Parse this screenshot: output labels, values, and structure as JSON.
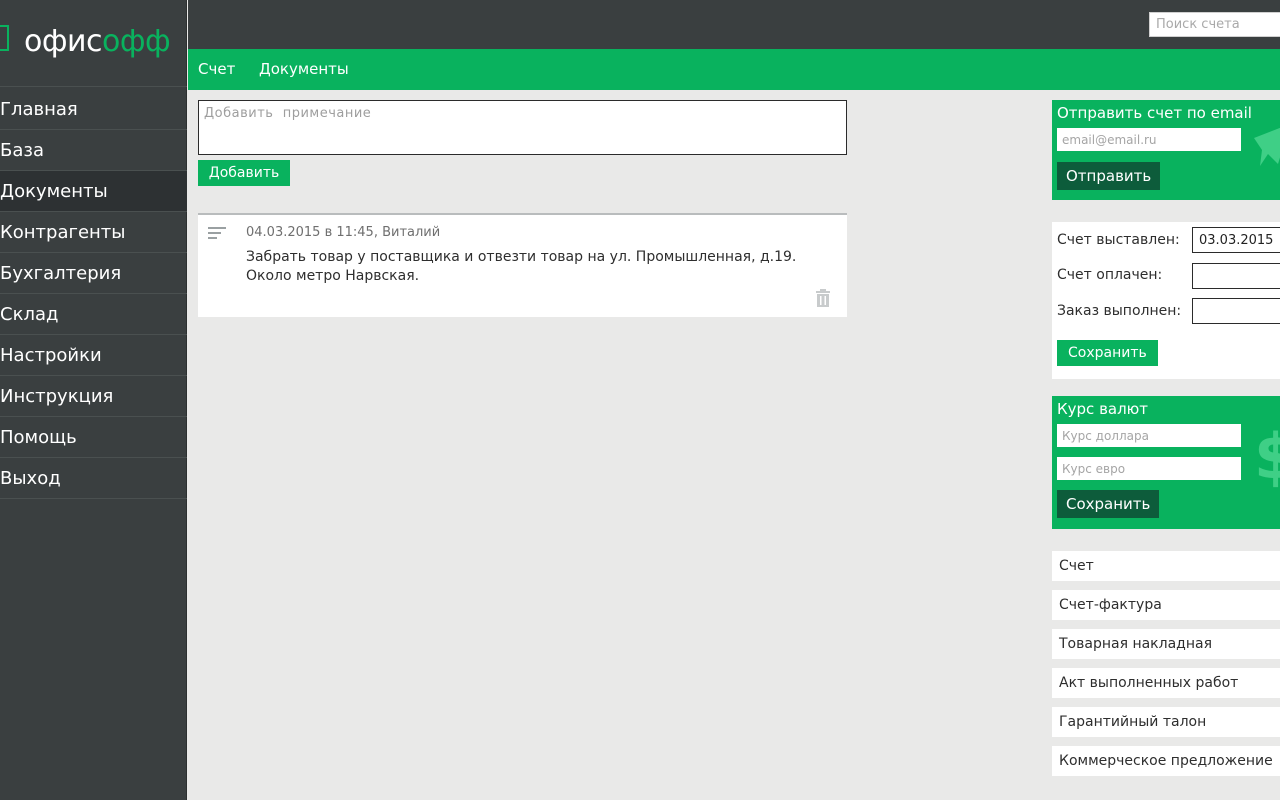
{
  "logo": {
    "part1": "офис",
    "part2": "офф"
  },
  "sidebar": {
    "items": [
      {
        "label": "Главная"
      },
      {
        "label": "База"
      },
      {
        "label": "Документы"
      },
      {
        "label": "Контрагенты"
      },
      {
        "label": "Бухгалтерия"
      },
      {
        "label": "Склад"
      },
      {
        "label": "Настройки"
      },
      {
        "label": "Инструкция"
      },
      {
        "label": "Помощь"
      },
      {
        "label": "Выход"
      }
    ],
    "active_index": 2
  },
  "search": {
    "placeholder": "Поиск счета",
    "value": ""
  },
  "tabs": [
    {
      "label": "Счет"
    },
    {
      "label": "Документы"
    }
  ],
  "note_form": {
    "placeholder": "Добавить  примечание",
    "add_label": "Добавить"
  },
  "notes": [
    {
      "meta": "04.03.2015 в 11:45, Виталий",
      "text": "Забрать товар у поставщика и отвезти товар на ул. Промышленная, д.19. Около метро Нарвская."
    }
  ],
  "email_panel": {
    "title": "Отправить счет по email",
    "placeholder": "email@email.ru",
    "send_label": "Отправить"
  },
  "status_panel": {
    "rows": [
      {
        "label": "Счет выставлен:",
        "value": "03.03.2015"
      },
      {
        "label": "Счет оплачен:",
        "value": ""
      },
      {
        "label": "Заказ выполнен:",
        "value": ""
      }
    ],
    "save_label": "Сохранить"
  },
  "currency_panel": {
    "title": "Курс валют",
    "dollar_placeholder": "Курс доллара",
    "euro_placeholder": "Курс евро",
    "save_label": "Сохранить"
  },
  "documents": [
    {
      "label": "Счет"
    },
    {
      "label": "Счет-фактура"
    },
    {
      "label": "Товарная накладная"
    },
    {
      "label": "Акт выполненных работ"
    },
    {
      "label": "Гарантийный талон"
    },
    {
      "label": "Коммерческое предложение"
    }
  ],
  "colors": {
    "accent": "#09b25e",
    "dark_button": "#0d5c3b",
    "sidebar": "#3a3f40",
    "sidebar_active": "#2d3133",
    "background": "#e9e9e8"
  },
  "icons": [
    "logo-mark-icon",
    "note-lines-icon",
    "trash-icon",
    "paper-plane-icon",
    "dollar-icon"
  ]
}
